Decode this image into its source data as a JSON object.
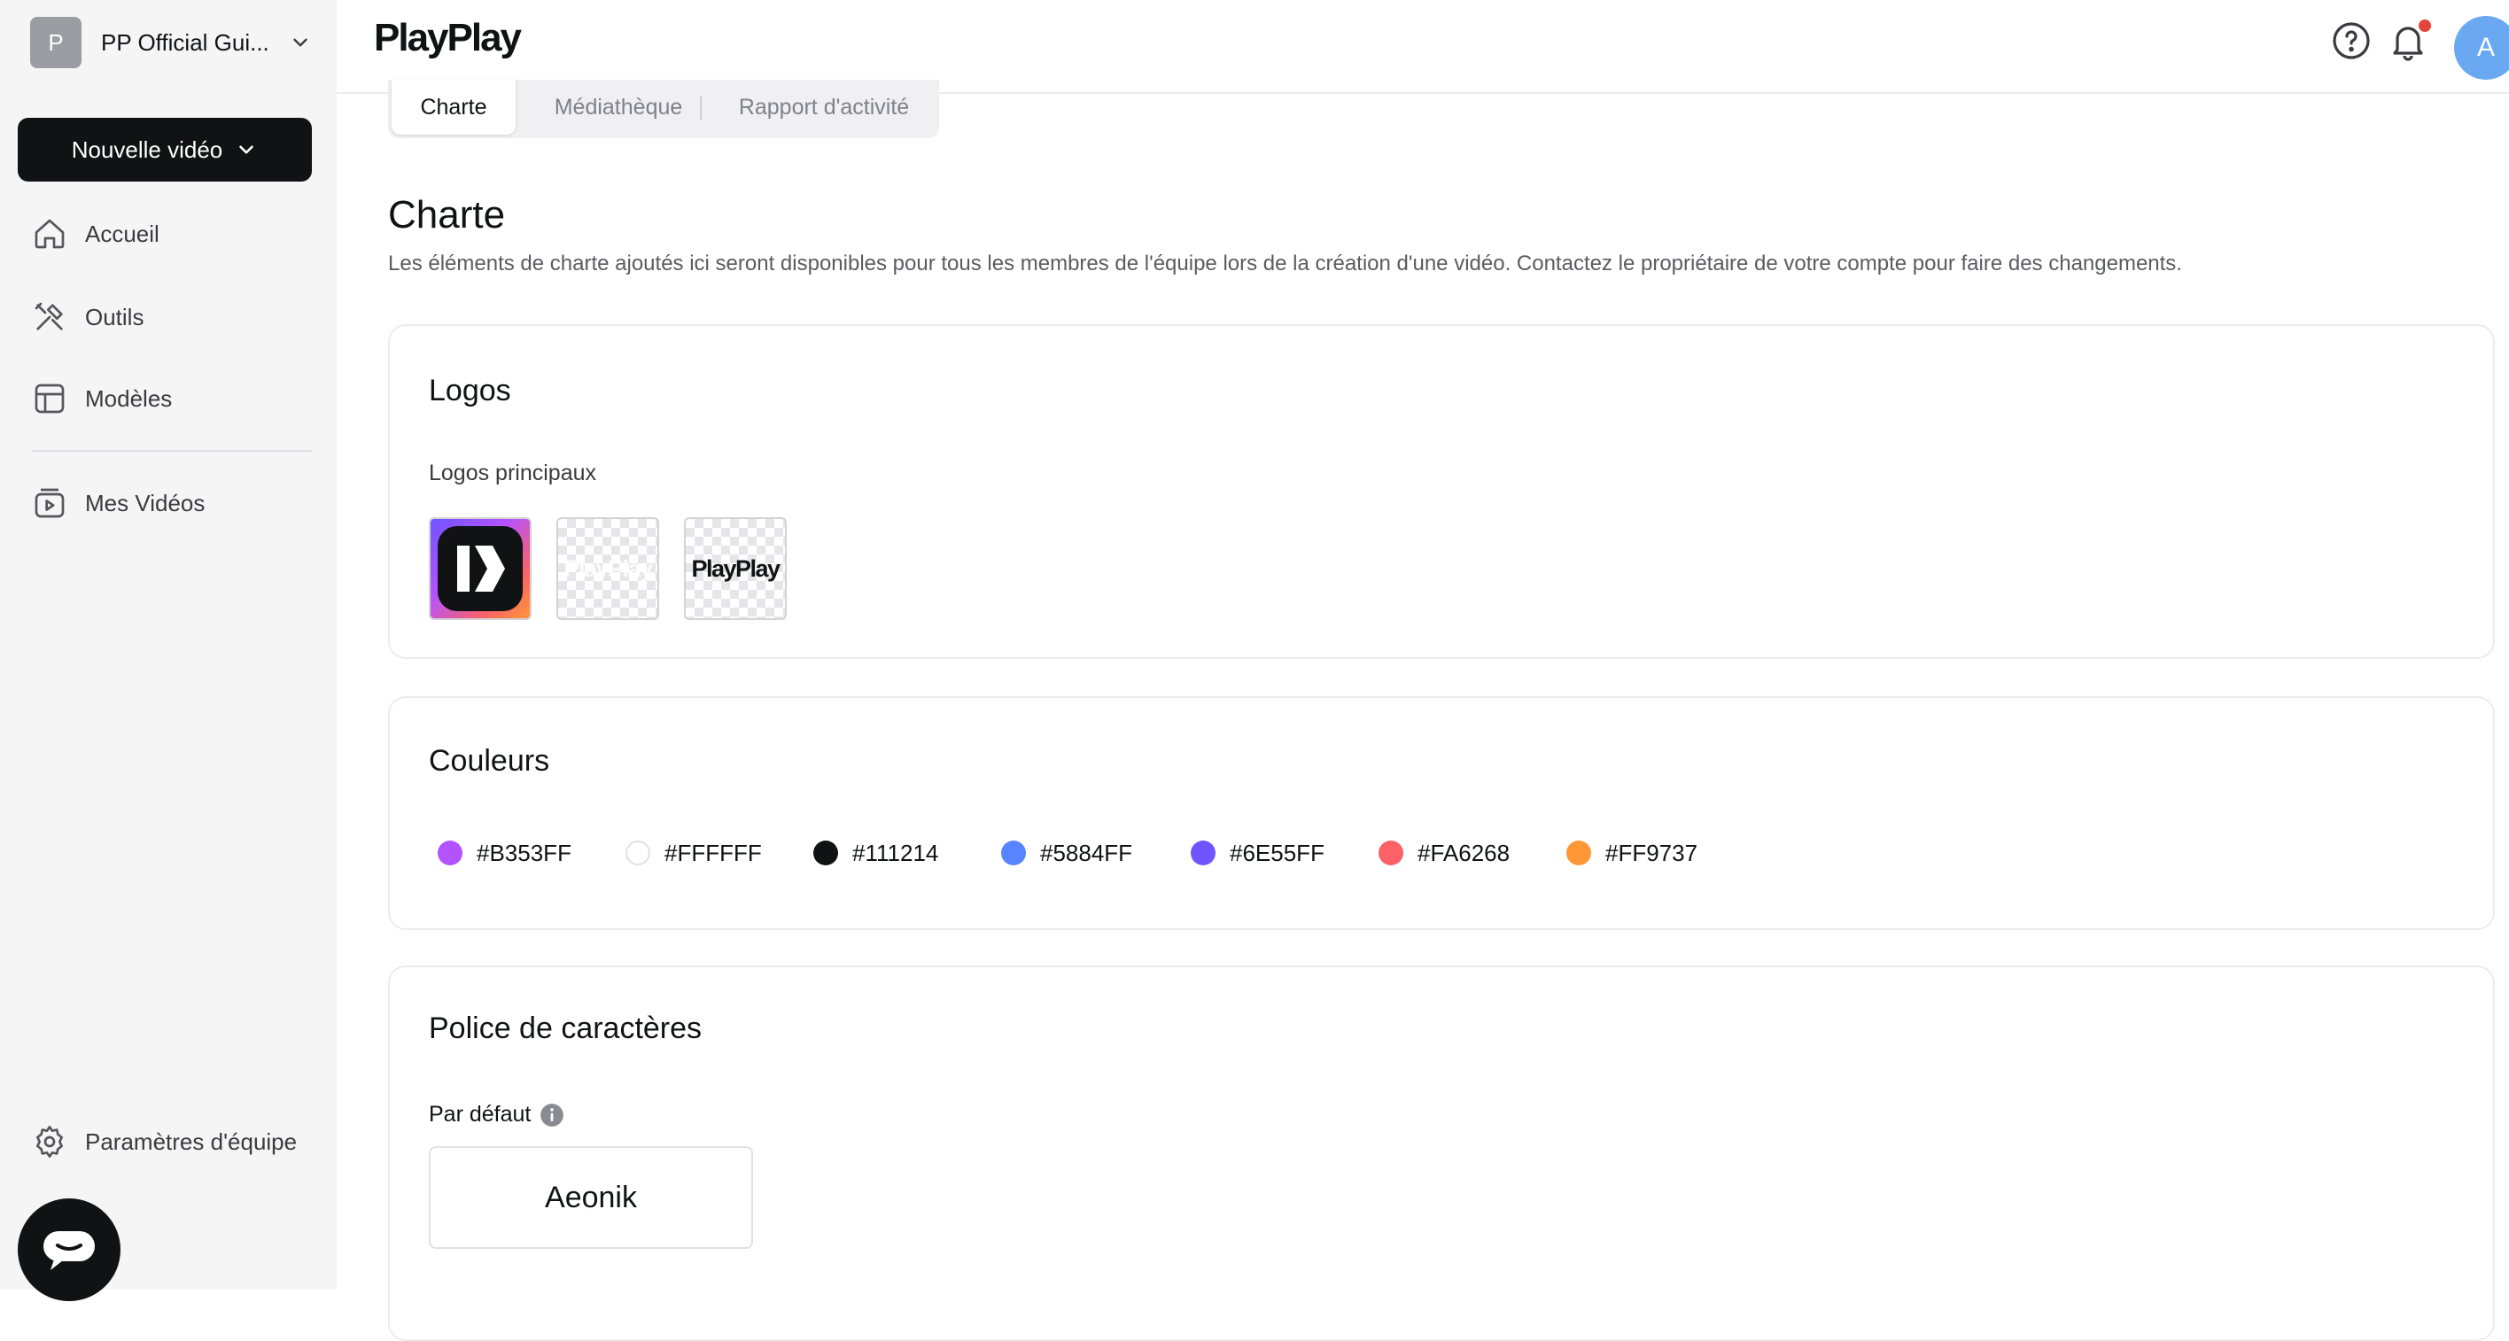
{
  "sidebar": {
    "team_initial": "P",
    "team_name": "PP Official Gui...",
    "new_video_label": "Nouvelle vidéo",
    "items": [
      {
        "label": "Accueil",
        "icon": "home-icon"
      },
      {
        "label": "Outils",
        "icon": "tools-icon"
      },
      {
        "label": "Modèles",
        "icon": "templates-icon"
      },
      {
        "label": "Mes Vidéos",
        "icon": "videos-icon"
      }
    ],
    "settings_label": "Paramètres d'équipe",
    "chat_icon": "chat-icon"
  },
  "topbar": {
    "brand": "PlayPlay",
    "help_icon": "help-icon",
    "notification_icon": "bell-icon",
    "user_initial": "A"
  },
  "tabs": [
    {
      "label": "Charte",
      "active": true
    },
    {
      "label": "Médiathèque",
      "active": false
    },
    {
      "label": "Rapport d'activité",
      "active": false
    }
  ],
  "page": {
    "title": "Charte",
    "description": "Les éléments de charte ajoutés ici seront disponibles pour tous les membres de l'équipe lors de la création d'une vidéo. Contactez le propriétaire de votre compte pour faire des changements."
  },
  "logos": {
    "title": "Logos",
    "subtitle": "Logos principaux",
    "wordmark": "PlayPlay"
  },
  "colors": {
    "title": "Couleurs",
    "swatches": [
      {
        "hex": "#B353FF"
      },
      {
        "hex": "#FFFFFF"
      },
      {
        "hex": "#111214"
      },
      {
        "hex": "#5884FF"
      },
      {
        "hex": "#6E55FF"
      },
      {
        "hex": "#FA6268"
      },
      {
        "hex": "#FF9737"
      }
    ]
  },
  "fonts": {
    "title": "Police de caractères",
    "default_label": "Par défaut",
    "default_font": "Aeonik"
  }
}
